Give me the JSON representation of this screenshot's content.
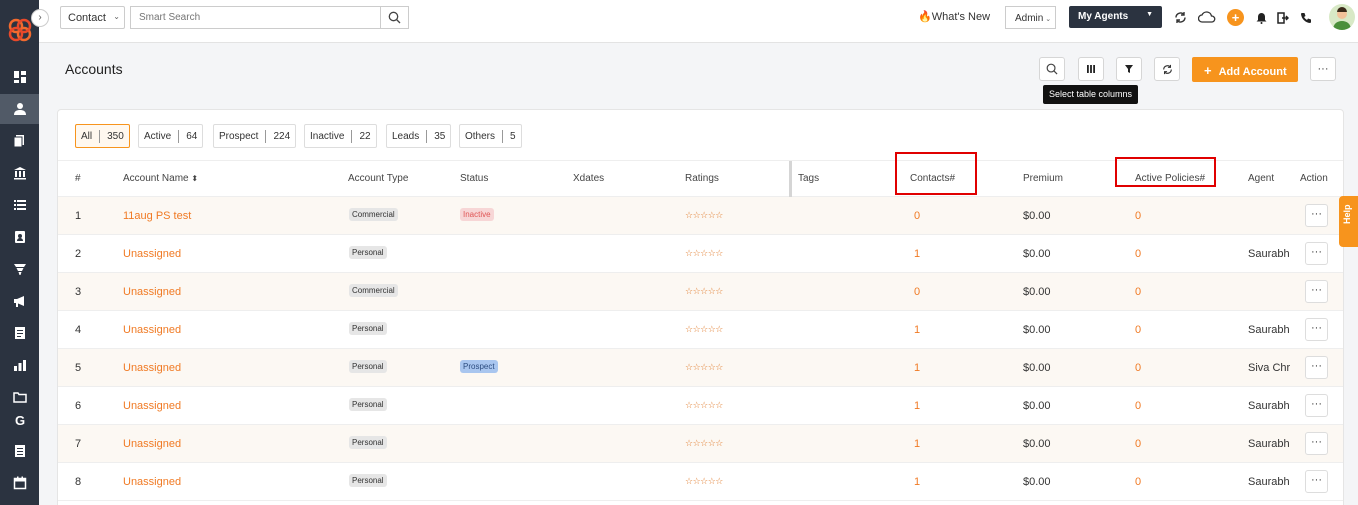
{
  "topbar": {
    "module": "Contact",
    "search_placeholder": "Smart Search",
    "whats_new": "What's New",
    "admin": "Admin",
    "my_agents": "My Agents"
  },
  "page": {
    "title": "Accounts",
    "add_button": "Add Account",
    "tooltip": "Select table columns",
    "help": "Help"
  },
  "filters": [
    {
      "label": "All",
      "count": "350"
    },
    {
      "label": "Active",
      "count": "64"
    },
    {
      "label": "Prospect",
      "count": "224"
    },
    {
      "label": "Inactive",
      "count": "22"
    },
    {
      "label": "Leads",
      "count": "35"
    },
    {
      "label": "Others",
      "count": "5"
    }
  ],
  "columns": {
    "num": "#",
    "name": "Account Name",
    "type": "Account Type",
    "status": "Status",
    "xdates": "Xdates",
    "ratings": "Ratings",
    "tags": "Tags",
    "contacts": "Contacts#",
    "premium": "Premium",
    "policies": "Active Policies#",
    "agent": "Agent",
    "action": "Action"
  },
  "rows": [
    {
      "num": "1",
      "name": "11aug PS test",
      "type": "Commercial",
      "status": "Inactive",
      "stars": "☆☆☆☆☆",
      "contacts": "0",
      "premium": "$0.00",
      "policies": "0",
      "agent": ""
    },
    {
      "num": "2",
      "name": "Unassigned",
      "type": "Personal",
      "status": "",
      "stars": "☆☆☆☆☆",
      "contacts": "1",
      "premium": "$0.00",
      "policies": "0",
      "agent": "Saurabh"
    },
    {
      "num": "3",
      "name": "Unassigned",
      "type": "Commercial",
      "status": "",
      "stars": "☆☆☆☆☆",
      "contacts": "0",
      "premium": "$0.00",
      "policies": "0",
      "agent": ""
    },
    {
      "num": "4",
      "name": "Unassigned",
      "type": "Personal",
      "status": "",
      "stars": "☆☆☆☆☆",
      "contacts": "1",
      "premium": "$0.00",
      "policies": "0",
      "agent": "Saurabh"
    },
    {
      "num": "5",
      "name": "Unassigned",
      "type": "Personal",
      "status": "Prospect",
      "stars": "☆☆☆☆☆",
      "contacts": "1",
      "premium": "$0.00",
      "policies": "0",
      "agent": "Siva Chr"
    },
    {
      "num": "6",
      "name": "Unassigned",
      "type": "Personal",
      "status": "",
      "stars": "☆☆☆☆☆",
      "contacts": "1",
      "premium": "$0.00",
      "policies": "0",
      "agent": "Saurabh"
    },
    {
      "num": "7",
      "name": "Unassigned",
      "type": "Personal",
      "status": "",
      "stars": "☆☆☆☆☆",
      "contacts": "1",
      "premium": "$0.00",
      "policies": "0",
      "agent": "Saurabh"
    },
    {
      "num": "8",
      "name": "Unassigned",
      "type": "Personal",
      "status": "",
      "stars": "☆☆☆☆☆",
      "contacts": "1",
      "premium": "$0.00",
      "policies": "0",
      "agent": "Saurabh"
    }
  ],
  "action_label": "···",
  "colors": {
    "accent": "#f7941d",
    "sidebar": "#2b3340",
    "highlight": "#e00000"
  }
}
